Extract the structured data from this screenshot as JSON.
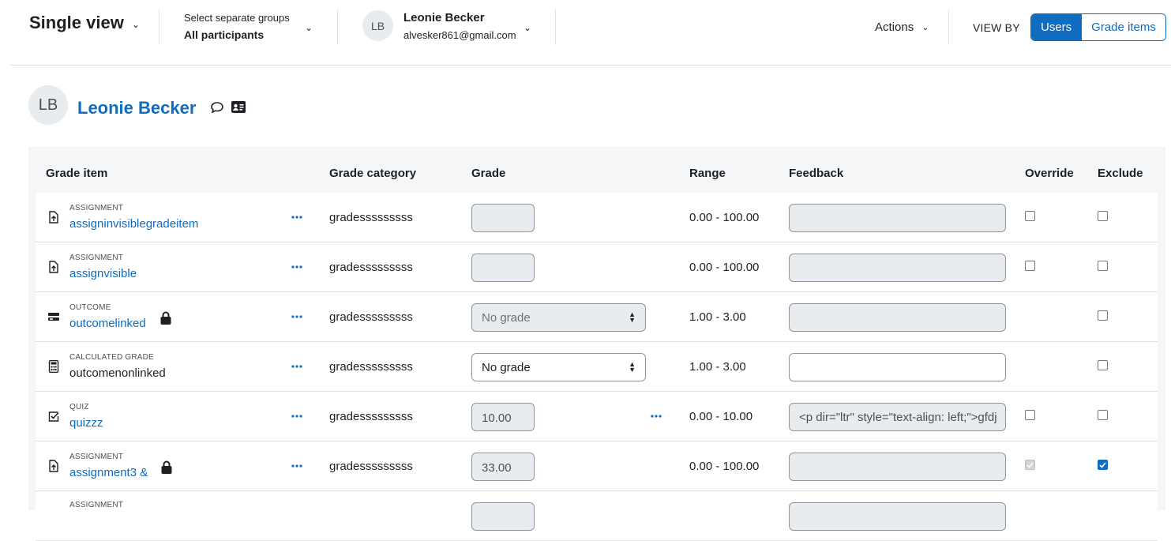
{
  "toolbar": {
    "title": "Single view",
    "groups_label": "Select separate groups",
    "groups_value": "All participants",
    "user_initials": "LB",
    "user_name": "Leonie Becker",
    "user_email": "alvesker861@gmail.com",
    "actions_label": "Actions",
    "view_by_label": "VIEW BY",
    "view_users": "Users",
    "view_grade_items": "Grade items",
    "accent_color": "#0f6cbf"
  },
  "user_header": {
    "initials": "LB",
    "name": "Leonie Becker",
    "icons": [
      "message-icon",
      "profile-card-icon"
    ]
  },
  "table": {
    "headers": {
      "grade_item": "Grade item",
      "grade_category": "Grade category",
      "grade": "Grade",
      "range": "Range",
      "feedback": "Feedback",
      "override": "Override",
      "exclude": "Exclude"
    },
    "rows": [
      {
        "type": "ASSIGNMENT",
        "name": "assigninvisiblegradeitem",
        "category": "gradesssssssss",
        "grade": "",
        "range": "0.00 - 100.00",
        "feedback": ""
      },
      {
        "type": "ASSIGNMENT",
        "name": "assignvisible",
        "category": "gradesssssssss",
        "grade": "",
        "range": "0.00 - 100.00",
        "feedback": ""
      },
      {
        "type": "OUTCOME",
        "name": "outcomelinked",
        "category": "gradesssssssss",
        "grade": "No grade",
        "range": "1.00 - 3.00",
        "feedback": ""
      },
      {
        "type": "CALCULATED GRADE",
        "name": "outcomenonlinked",
        "category": "gradesssssssss",
        "grade": "No grade",
        "range": "1.00 - 3.00",
        "feedback": ""
      },
      {
        "type": "QUIZ",
        "name": "quizzz",
        "category": "gradesssssssss",
        "grade": "10.00",
        "range": "0.00 - 10.00",
        "feedback": "<p dir=\"ltr\" style=\"text-align: left;\">gfdj"
      },
      {
        "type": "ASSIGNMENT",
        "name": "assignment3 &",
        "category": "gradesssssssss",
        "grade": "33.00",
        "range": "0.00 - 100.00",
        "feedback": ""
      },
      {
        "type": "ASSIGNMENT",
        "name": "",
        "category": "",
        "grade": "",
        "range": "",
        "feedback": ""
      }
    ]
  }
}
